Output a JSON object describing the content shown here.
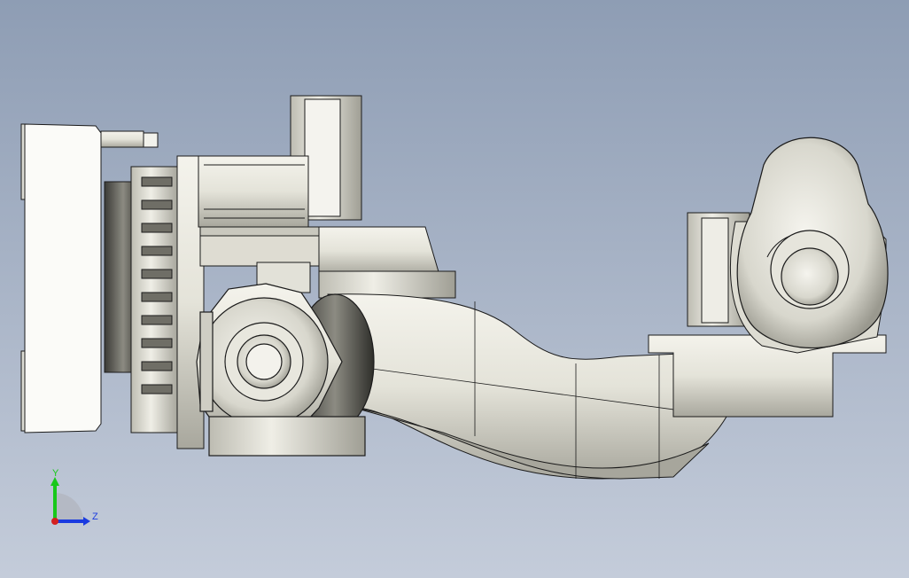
{
  "viewport": {
    "background_top": "#8e9db4",
    "background_bottom": "#c4ccda"
  },
  "model": {
    "body_color": "#e9e8df",
    "shade_color": "#a9a89f",
    "edge_color": "#1b1b1b"
  },
  "triad": {
    "y_label": "Y",
    "z_label": "Z",
    "y_color": "#18c81a",
    "z_color": "#1a3be0",
    "x_color": "#d42020"
  }
}
